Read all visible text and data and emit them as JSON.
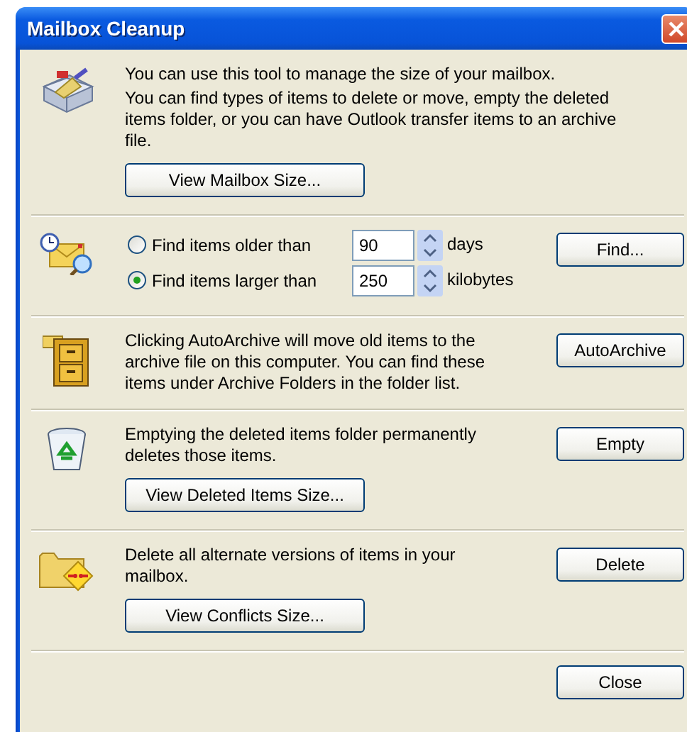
{
  "window": {
    "title": "Mailbox Cleanup"
  },
  "sections": [
    {
      "kind": "info",
      "paragraphs": [
        "You can use this tool to manage the size of your mailbox.",
        "You can find types of items to delete or move, empty the deleted items folder, or you can have Outlook transfer items to an archive file."
      ],
      "buttons": [
        {
          "label": "View Mailbox Size..."
        }
      ]
    },
    {
      "kind": "find",
      "options": [
        {
          "label": "Find items older than",
          "selected": false,
          "value": "90",
          "unit": "days"
        },
        {
          "label": "Find items larger than",
          "selected": true,
          "value": "250",
          "unit": "kilobytes"
        }
      ],
      "side_button": {
        "label": "Find..."
      }
    },
    {
      "kind": "info",
      "paragraphs": [
        "Clicking AutoArchive will move old items to the archive file on this computer. You can find these items under Archive Folders in the folder list."
      ],
      "side_button": {
        "label": "AutoArchive"
      }
    },
    {
      "kind": "info",
      "paragraphs": [
        "Emptying the deleted items folder permanently deletes those items."
      ],
      "buttons": [
        {
          "label": "View Deleted Items Size..."
        }
      ],
      "side_button": {
        "label": "Empty"
      }
    },
    {
      "kind": "info",
      "paragraphs": [
        "Delete all alternate versions of items in your mailbox."
      ],
      "buttons": [
        {
          "label": "View Conflicts Size..."
        }
      ],
      "side_button": {
        "label": "Delete"
      }
    }
  ],
  "close_button": {
    "label": "Close"
  }
}
